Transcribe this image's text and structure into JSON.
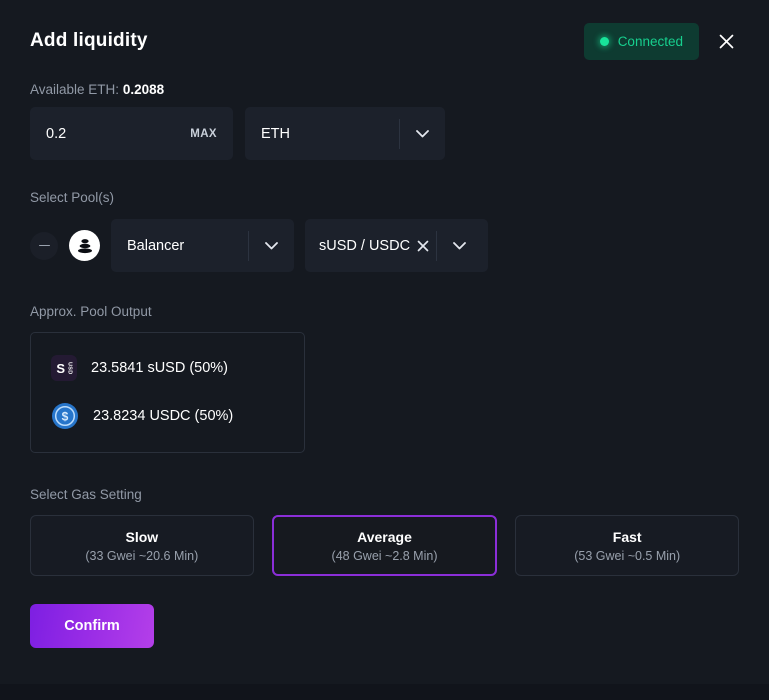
{
  "header": {
    "title": "Add liquidity",
    "connected_label": "Connected",
    "connected_color": "#17cf8e",
    "connected_bg": "#0e3b31",
    "close_icon": "close-icon"
  },
  "balance": {
    "label": "Available ETH:",
    "value": "0.2088"
  },
  "amount": {
    "value": "0.2",
    "placeholder": "0.0",
    "max_label": "MAX",
    "token": "ETH",
    "chevron_icon": "chevron-down-icon"
  },
  "pool": {
    "section_label": "Select Pool(s)",
    "remove_icon": "minus-icon",
    "protocol_logo_icon": "balancer-logo-icon",
    "protocol": "Balancer",
    "pair": "sUSD / USDC",
    "clear_icon": "close-icon",
    "chevron_icon": "chevron-down-icon"
  },
  "output": {
    "section_label": "Approx. Pool Output",
    "items": [
      {
        "icon": "susd-token-icon",
        "text": "23.5841 sUSD (50%)",
        "symbol": "sUSD",
        "amount": "23.5841",
        "share": "50%"
      },
      {
        "icon": "usdc-token-icon",
        "text": "23.8234 USDC (50%)",
        "symbol": "USDC",
        "amount": "23.8234",
        "share": "50%"
      }
    ]
  },
  "gas": {
    "section_label": "Select Gas Setting",
    "selected": "Average",
    "selected_border_color": "#8b2ed8",
    "options": [
      {
        "name": "Slow",
        "detail": "(33 Gwei ~20.6 Min)",
        "gwei": "33",
        "time": "~20.6 Min",
        "selected": false
      },
      {
        "name": "Average",
        "detail": "(48 Gwei ~2.8 Min)",
        "gwei": "48",
        "time": "~2.8 Min",
        "selected": true
      },
      {
        "name": "Fast",
        "detail": "(53 Gwei ~0.5 Min)",
        "gwei": "53",
        "time": "~0.5 Min",
        "selected": false
      }
    ]
  },
  "confirm": {
    "label": "Confirm",
    "gradient_from": "#7d1fe2",
    "gradient_to": "#b43fe9"
  }
}
